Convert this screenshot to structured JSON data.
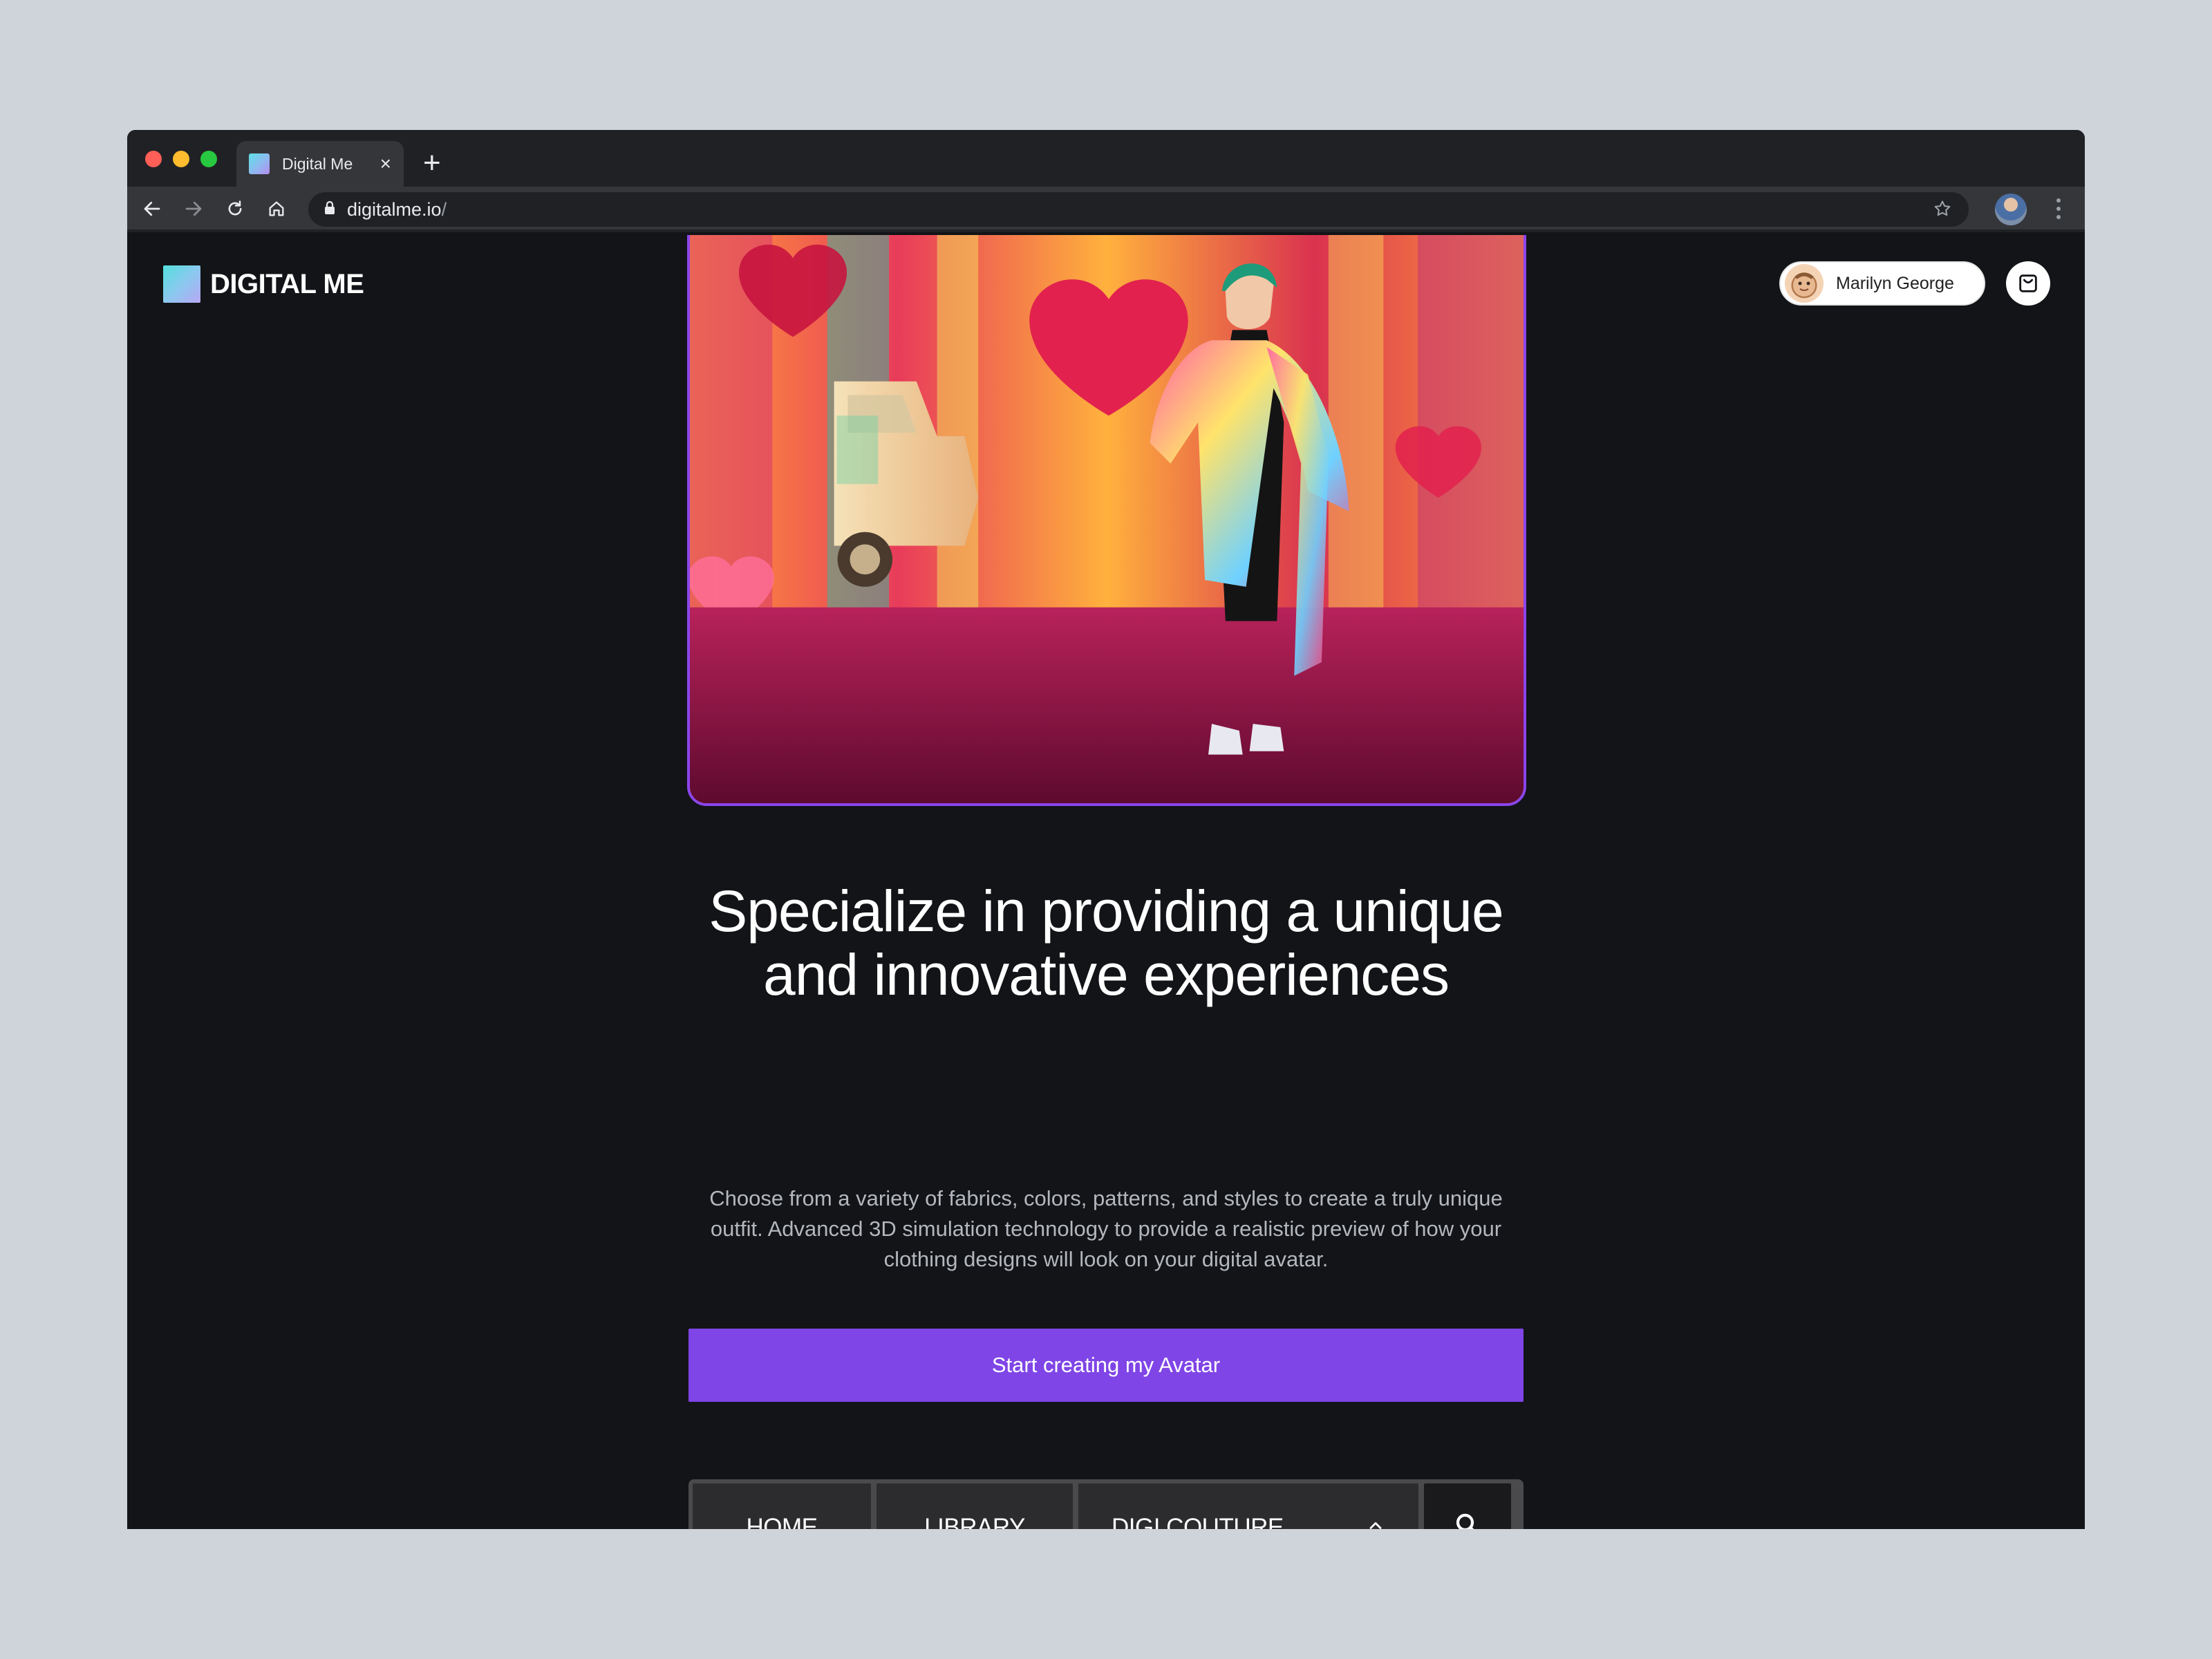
{
  "browser": {
    "tab_title": "Digital Me",
    "tab_close": "×",
    "new_tab": "+",
    "url": "digitalme.io",
    "url_suffix": "/"
  },
  "header": {
    "brand": "DIGITAL ME",
    "user_name": "Marilyn George"
  },
  "hero": {
    "image": "avatar in puffer coat beside taxi, heart-pattern backdrop",
    "headline": "Specialize in providing a unique and innovative experiences",
    "subcopy": "Choose from a variety of fabrics, colors, patterns, and styles to create a truly unique outfit. Advanced 3D simulation technology to provide a realistic preview of how your clothing designs will look on your digital avatar.",
    "cta": "Start creating my Avatar"
  },
  "nav": {
    "home": "HOME",
    "library": "LIBRARY",
    "couture": "DIGI COUTURE"
  },
  "colors": {
    "accent": "#7f45e6",
    "hero_border": "#8b45ec",
    "page_bg": "#121417"
  },
  "icons": [
    "back-icon",
    "forward-icon",
    "reload-icon",
    "home-icon",
    "lock-icon",
    "star-icon",
    "cart-icon",
    "chevron-up-icon",
    "search-icon"
  ]
}
